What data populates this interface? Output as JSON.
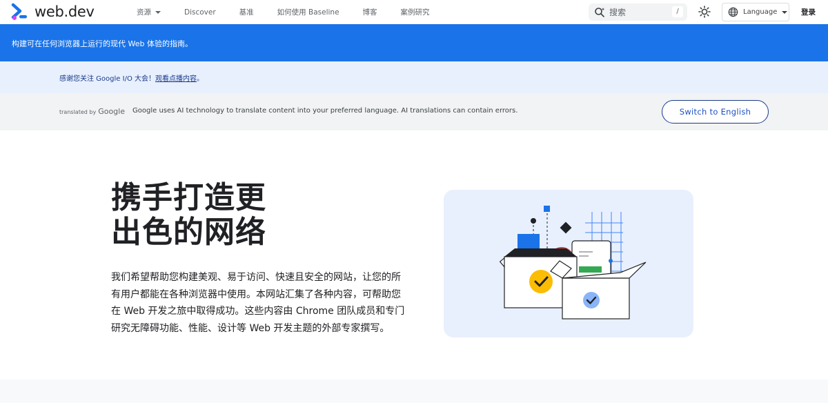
{
  "header": {
    "logo_text": "web.dev",
    "nav": [
      {
        "label": "资源",
        "dropdown": true
      },
      {
        "label": "Discover"
      },
      {
        "label": "基准"
      },
      {
        "label": "如何使用 Baseline"
      },
      {
        "label": "博客"
      },
      {
        "label": "案例研究"
      }
    ],
    "search_placeholder": "搜索",
    "search_shortcut": "/",
    "language_label": "Language",
    "signin_label": "登录"
  },
  "banner": {
    "tagline": "构建可在任何浏览器上运行的现代 Web 体验的指南。"
  },
  "notice": {
    "text": "感谢您关注 Google I/O 大会！",
    "link_text": "观看点播内容",
    "suffix": "。"
  },
  "translate": {
    "translated_by": "translated by",
    "google": "Google",
    "message": "Google uses AI technology to translate content into your preferred language. AI translations can contain errors.",
    "switch_label": "Switch to English"
  },
  "hero": {
    "title_line1": "携手打造更",
    "title_line2": "出色的网络",
    "description": "我们希望帮助您构建美观、易于访问、快速且安全的网站，让您的所有用户都能在各种浏览器中使用。本网站汇集了各种内容，可帮助您在 Web 开发之旅中取得成功。这些内容由 Chrome 团队成员和专门研究无障碍功能、性能、设计等 Web 开发主题的外部专家撰写。"
  },
  "colors": {
    "brand_blue": "#1a73e8",
    "notice_bg": "#e8f0fe",
    "translate_bg": "#f1f3f4"
  }
}
